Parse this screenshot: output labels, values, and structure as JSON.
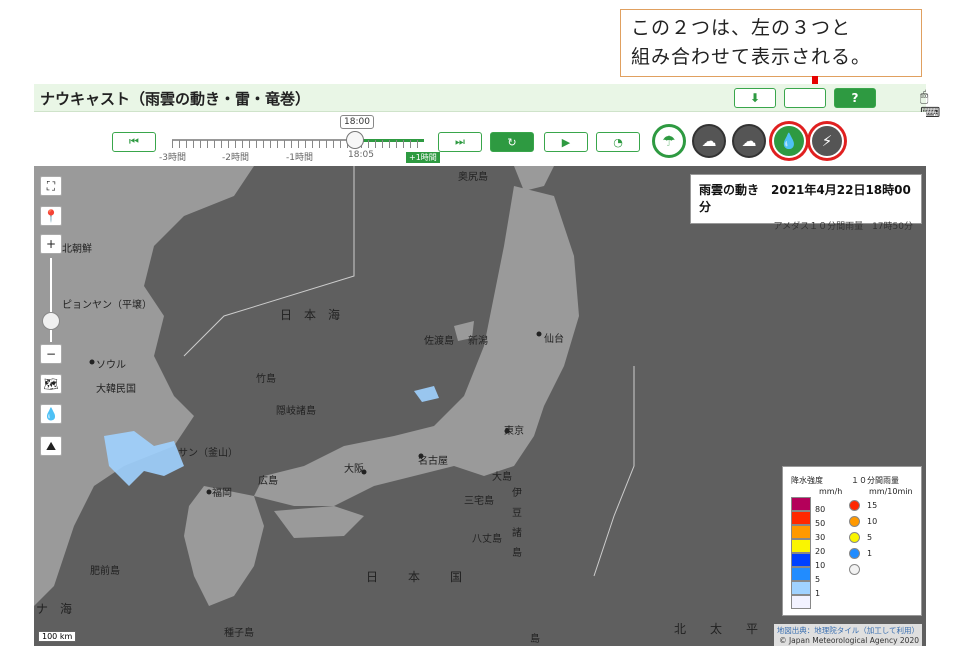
{
  "callout": {
    "line1": "この２つは、左の３つと",
    "line2": "組み合わせて表示される。"
  },
  "app": {
    "title": "ナウキャスト（雨雲の動き・雷・竜巻）"
  },
  "header_buttons": {
    "download": "⬇",
    "help": "?"
  },
  "timeline": {
    "current": "18:00",
    "ticks": [
      "-3時間",
      "-2時間",
      "-1時間",
      "18:05"
    ],
    "plus": "+1時間"
  },
  "controls": {
    "first": "⏮",
    "last": "⏭",
    "refresh": "↻",
    "play": "▶",
    "speed": "◔"
  },
  "info": {
    "main": "雨雲の動き　2021年4月22日18時00分",
    "sub": "アメダス１０分間雨量　17時50分"
  },
  "legend": {
    "left_title": "降水強度",
    "left_unit": "mm/h",
    "left_levels": [
      {
        "label": "80",
        "color": "#b4005a"
      },
      {
        "label": "50",
        "color": "#ff2800"
      },
      {
        "label": "30",
        "color": "#ff9900"
      },
      {
        "label": "20",
        "color": "#faf500"
      },
      {
        "label": "10",
        "color": "#0041ff"
      },
      {
        "label": "5",
        "color": "#218cff"
      },
      {
        "label": "1",
        "color": "#a0d2ff"
      },
      {
        "label": "",
        "color": "#f2f2ff"
      }
    ],
    "right_title": "１０分間雨量",
    "right_unit": "mm/10min",
    "right_levels": [
      {
        "label": "15",
        "color": "#ff2800"
      },
      {
        "label": "10",
        "color": "#ff9900"
      },
      {
        "label": "5",
        "color": "#faf500"
      },
      {
        "label": "1",
        "color": "#218cff"
      },
      {
        "label": "",
        "color": "#f2f2f2"
      }
    ]
  },
  "map_labels": {
    "north_korea": "北朝鮮",
    "pyongyang": "ピョンヤン（平壌）",
    "seoul": "ソウル",
    "korea": "大韓民国",
    "busan": "サン（釜山）",
    "sea_of_japan": "日本海",
    "sado": "佐渡島",
    "niigata": "新潟",
    "sendai": "仙台",
    "takeshima": "竹島",
    "oki": "隠岐諸島",
    "hiroshima": "広島",
    "osaka": "大阪",
    "nagoya": "名古屋",
    "tokyo": "東京",
    "fukuoka": "福岡",
    "okushiri": "奥尻島",
    "oshima": "大島",
    "miyake": "三宅島",
    "hachijo": "八丈島",
    "izu": "伊豆諸島",
    "hizen": "肥前島",
    "tanegashima": "種子島",
    "naha": "ナ海",
    "japan": "日本国",
    "north_pacific": "北太平",
    "bottom_island": "島"
  },
  "credit": {
    "line1": "地図出典：地理院タイル（加工して利用）",
    "line2": "© Japan Meteorological Agency 2020"
  },
  "scale": "100 km"
}
